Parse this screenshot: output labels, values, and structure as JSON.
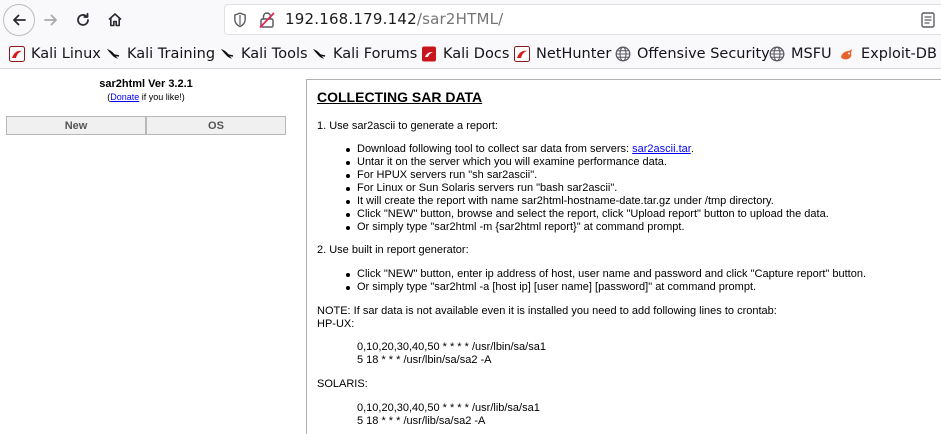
{
  "browser": {
    "url_host": "192.168.179.142",
    "url_path": "/sar2HTML/"
  },
  "bookmarks": [
    {
      "label": "Kali Linux",
      "icon": "kali-red-icon"
    },
    {
      "label": "Kali Training",
      "icon": "kali-dragon-icon"
    },
    {
      "label": "Kali Tools",
      "icon": "kali-dragon-icon"
    },
    {
      "label": "Kali Forums",
      "icon": "kali-dragon-icon"
    },
    {
      "label": "Kali Docs",
      "icon": "kali-docs-icon"
    },
    {
      "label": "NetHunter",
      "icon": "kali-red-icon"
    },
    {
      "label": "Offensive Security",
      "icon": "globe-icon"
    },
    {
      "label": "MSFU",
      "icon": "globe-icon"
    },
    {
      "label": "Exploit-DB",
      "icon": "exploit-db-icon"
    }
  ],
  "sidebar": {
    "title": "sar2html Ver 3.2.1",
    "donate_prefix": "(",
    "donate_link": "Donate",
    "donate_suffix": " if you like!)",
    "buttons": [
      "New",
      "OS"
    ]
  },
  "main": {
    "title": "COLLECTING SAR DATA",
    "step1": "1. Use sar2ascii to generate a report:",
    "step1_download_prefix": "Download following tool to collect sar data from servers: ",
    "step1_download_link": "sar2ascii.tar",
    "step1_download_suffix": ".",
    "step1_items": [
      "Untar it on the server which you will examine performance data.",
      "For HPUX servers run \"sh sar2ascii\".",
      "For Linux or Sun Solaris servers run \"bash sar2ascii\".",
      "It will create the report with name sar2html-hostname-date.tar.gz under /tmp directory.",
      "Click \"NEW\" button, browse and select the report, click \"Upload report\" button to upload the data.",
      "Or simply type \"sar2html -m {sar2html report}\" at command prompt."
    ],
    "step2": "2. Use built in report generator:",
    "step2_items": [
      "Click \"NEW\" button, enter ip address of host, user name and password and click \"Capture report\" button.",
      "Or simply type \"sar2html -a [host ip] [user name] [password]\" at command prompt."
    ],
    "note": "NOTE: If sar data is not available even it is installed you need to add following lines to crontab:",
    "hpux_label": "HP-UX:",
    "hpux_lines": [
      "0,10,20,30,40,50 * * * * /usr/lbin/sa/sa1",
      "5 18 * * * /usr/lbin/sa/sa2 -A"
    ],
    "solaris_label": "SOLARIS:",
    "solaris_lines": [
      "0,10,20,30,40,50 * * * * /usr/lib/sa/sa1",
      "5 18 * * * /usr/lib/sa/sa2 -A"
    ]
  }
}
